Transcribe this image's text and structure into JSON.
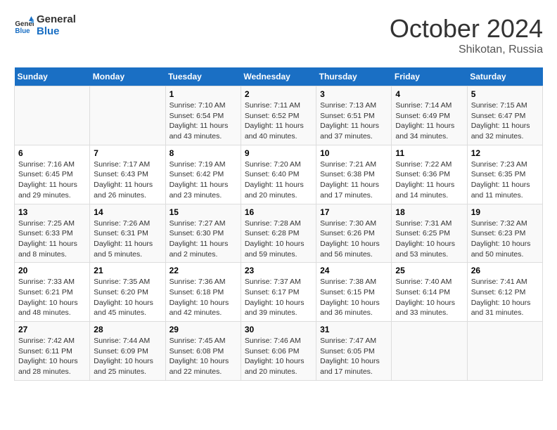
{
  "header": {
    "logo_line1": "General",
    "logo_line2": "Blue",
    "month": "October 2024",
    "location": "Shikotan, Russia"
  },
  "days_of_week": [
    "Sunday",
    "Monday",
    "Tuesday",
    "Wednesday",
    "Thursday",
    "Friday",
    "Saturday"
  ],
  "weeks": [
    [
      {
        "day": "",
        "content": ""
      },
      {
        "day": "",
        "content": ""
      },
      {
        "day": "1",
        "content": "Sunrise: 7:10 AM\nSunset: 6:54 PM\nDaylight: 11 hours and 43 minutes."
      },
      {
        "day": "2",
        "content": "Sunrise: 7:11 AM\nSunset: 6:52 PM\nDaylight: 11 hours and 40 minutes."
      },
      {
        "day": "3",
        "content": "Sunrise: 7:13 AM\nSunset: 6:51 PM\nDaylight: 11 hours and 37 minutes."
      },
      {
        "day": "4",
        "content": "Sunrise: 7:14 AM\nSunset: 6:49 PM\nDaylight: 11 hours and 34 minutes."
      },
      {
        "day": "5",
        "content": "Sunrise: 7:15 AM\nSunset: 6:47 PM\nDaylight: 11 hours and 32 minutes."
      }
    ],
    [
      {
        "day": "6",
        "content": "Sunrise: 7:16 AM\nSunset: 6:45 PM\nDaylight: 11 hours and 29 minutes."
      },
      {
        "day": "7",
        "content": "Sunrise: 7:17 AM\nSunset: 6:43 PM\nDaylight: 11 hours and 26 minutes."
      },
      {
        "day": "8",
        "content": "Sunrise: 7:19 AM\nSunset: 6:42 PM\nDaylight: 11 hours and 23 minutes."
      },
      {
        "day": "9",
        "content": "Sunrise: 7:20 AM\nSunset: 6:40 PM\nDaylight: 11 hours and 20 minutes."
      },
      {
        "day": "10",
        "content": "Sunrise: 7:21 AM\nSunset: 6:38 PM\nDaylight: 11 hours and 17 minutes."
      },
      {
        "day": "11",
        "content": "Sunrise: 7:22 AM\nSunset: 6:36 PM\nDaylight: 11 hours and 14 minutes."
      },
      {
        "day": "12",
        "content": "Sunrise: 7:23 AM\nSunset: 6:35 PM\nDaylight: 11 hours and 11 minutes."
      }
    ],
    [
      {
        "day": "13",
        "content": "Sunrise: 7:25 AM\nSunset: 6:33 PM\nDaylight: 11 hours and 8 minutes."
      },
      {
        "day": "14",
        "content": "Sunrise: 7:26 AM\nSunset: 6:31 PM\nDaylight: 11 hours and 5 minutes."
      },
      {
        "day": "15",
        "content": "Sunrise: 7:27 AM\nSunset: 6:30 PM\nDaylight: 11 hours and 2 minutes."
      },
      {
        "day": "16",
        "content": "Sunrise: 7:28 AM\nSunset: 6:28 PM\nDaylight: 10 hours and 59 minutes."
      },
      {
        "day": "17",
        "content": "Sunrise: 7:30 AM\nSunset: 6:26 PM\nDaylight: 10 hours and 56 minutes."
      },
      {
        "day": "18",
        "content": "Sunrise: 7:31 AM\nSunset: 6:25 PM\nDaylight: 10 hours and 53 minutes."
      },
      {
        "day": "19",
        "content": "Sunrise: 7:32 AM\nSunset: 6:23 PM\nDaylight: 10 hours and 50 minutes."
      }
    ],
    [
      {
        "day": "20",
        "content": "Sunrise: 7:33 AM\nSunset: 6:21 PM\nDaylight: 10 hours and 48 minutes."
      },
      {
        "day": "21",
        "content": "Sunrise: 7:35 AM\nSunset: 6:20 PM\nDaylight: 10 hours and 45 minutes."
      },
      {
        "day": "22",
        "content": "Sunrise: 7:36 AM\nSunset: 6:18 PM\nDaylight: 10 hours and 42 minutes."
      },
      {
        "day": "23",
        "content": "Sunrise: 7:37 AM\nSunset: 6:17 PM\nDaylight: 10 hours and 39 minutes."
      },
      {
        "day": "24",
        "content": "Sunrise: 7:38 AM\nSunset: 6:15 PM\nDaylight: 10 hours and 36 minutes."
      },
      {
        "day": "25",
        "content": "Sunrise: 7:40 AM\nSunset: 6:14 PM\nDaylight: 10 hours and 33 minutes."
      },
      {
        "day": "26",
        "content": "Sunrise: 7:41 AM\nSunset: 6:12 PM\nDaylight: 10 hours and 31 minutes."
      }
    ],
    [
      {
        "day": "27",
        "content": "Sunrise: 7:42 AM\nSunset: 6:11 PM\nDaylight: 10 hours and 28 minutes."
      },
      {
        "day": "28",
        "content": "Sunrise: 7:44 AM\nSunset: 6:09 PM\nDaylight: 10 hours and 25 minutes."
      },
      {
        "day": "29",
        "content": "Sunrise: 7:45 AM\nSunset: 6:08 PM\nDaylight: 10 hours and 22 minutes."
      },
      {
        "day": "30",
        "content": "Sunrise: 7:46 AM\nSunset: 6:06 PM\nDaylight: 10 hours and 20 minutes."
      },
      {
        "day": "31",
        "content": "Sunrise: 7:47 AM\nSunset: 6:05 PM\nDaylight: 10 hours and 17 minutes."
      },
      {
        "day": "",
        "content": ""
      },
      {
        "day": "",
        "content": ""
      }
    ]
  ]
}
